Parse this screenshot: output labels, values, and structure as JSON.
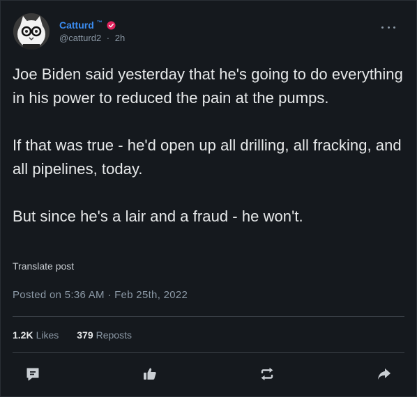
{
  "author": {
    "display_name": "Catturd",
    "tm": "™",
    "handle": "@catturd2",
    "separator": "·",
    "time_ago": "2h",
    "badge_icon": "verified-badge-icon",
    "name_color": "#3b8cf0",
    "badge_color": "#e0245e"
  },
  "tweet": {
    "paragraphs": [
      "Joe Biden said yesterday that he's going to do everything in his power to reduced the pain at the pumps.",
      "If that was true - he'd open up all drilling, all fracking, and all pipelines, today.",
      "But since he's a lair and a fraud - he won't."
    ],
    "translate_label": "Translate post",
    "posted": "Posted on 5:36 AM · Feb 25th, 2022"
  },
  "stats": {
    "likes_count": "1.2K",
    "likes_label": "Likes",
    "reposts_count": "379",
    "reposts_label": "Reposts"
  },
  "actions": [
    {
      "name": "reply",
      "icon": "reply-icon"
    },
    {
      "name": "like",
      "icon": "thumbs-up-icon"
    },
    {
      "name": "repost",
      "icon": "repost-icon"
    },
    {
      "name": "share",
      "icon": "share-icon"
    }
  ],
  "menu": {
    "icon": "more-options-icon"
  }
}
